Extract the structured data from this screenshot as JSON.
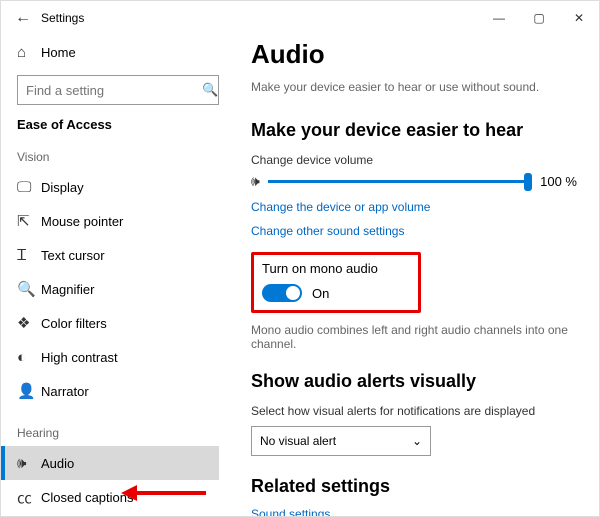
{
  "window": {
    "title": "Settings"
  },
  "sidebar": {
    "home": "Home",
    "search_placeholder": "Find a setting",
    "ease": "Ease of Access",
    "vision_header": "Vision",
    "hearing_header": "Hearing",
    "vision": [
      {
        "label": "Display"
      },
      {
        "label": "Mouse pointer"
      },
      {
        "label": "Text cursor"
      },
      {
        "label": "Magnifier"
      },
      {
        "label": "Color filters"
      },
      {
        "label": "High contrast"
      },
      {
        "label": "Narrator"
      }
    ],
    "hearing": [
      {
        "label": "Audio"
      },
      {
        "label": "Closed captions"
      }
    ]
  },
  "page": {
    "title": "Audio",
    "desc": "Make your device easier to hear or use without sound.",
    "section_hear": "Make your device easier to hear",
    "volume_label": "Change device volume",
    "volume_value": "100 %",
    "link_device": "Change the device or app volume",
    "link_other": "Change other sound settings",
    "mono_title": "Turn on mono audio",
    "mono_state": "On",
    "mono_desc": "Mono audio combines left and right audio channels into one channel.",
    "section_visual": "Show audio alerts visually",
    "visual_label": "Select how visual alerts for notifications are displayed",
    "visual_select": "No visual alert",
    "section_related": "Related settings",
    "link_sound": "Sound settings"
  }
}
